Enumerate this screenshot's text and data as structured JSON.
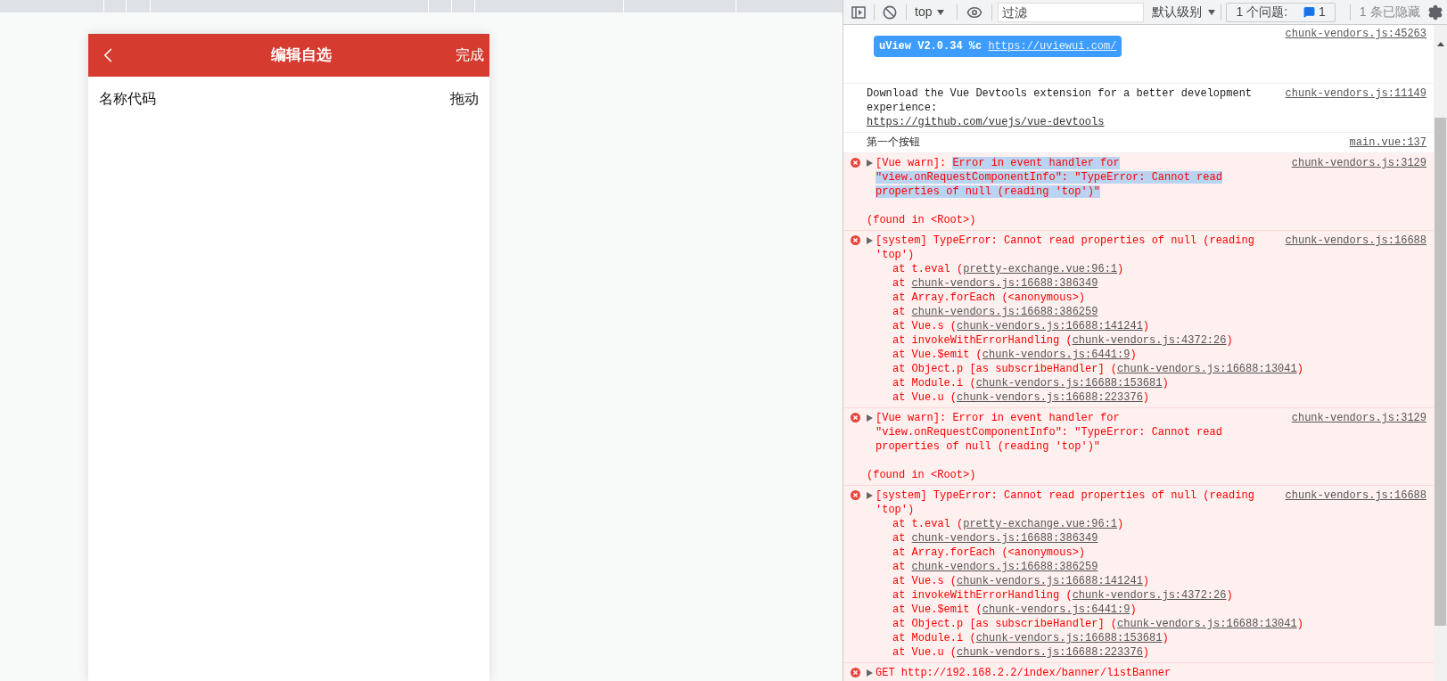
{
  "phone": {
    "header": {
      "title": "编辑自选",
      "action": "完成"
    },
    "list_header": {
      "name_column": "名称代码",
      "drag_column": "拖动"
    }
  },
  "devtools": {
    "toolbar": {
      "context": "top",
      "filter_placeholder": "过滤",
      "level": "默认级别",
      "issues_label": "1 个问题:",
      "issues_count": "1",
      "hidden": "1 条已隐藏"
    },
    "messages": [
      {
        "kind": "banner",
        "source": "chunk-vendors.js:45263",
        "badge_text": "uView V2.0.34 %c ",
        "badge_link": "https://uviewui.com/"
      },
      {
        "kind": "log",
        "source": "chunk-vendors.js:11149",
        "text": "Download the Vue Devtools extension for a better development experience:",
        "link": "https://github.com/vuejs/vue-devtools"
      },
      {
        "kind": "log",
        "source": "main.vue:137",
        "text": "第一个按钮"
      },
      {
        "kind": "error",
        "expanded": false,
        "source": "chunk-vendors.js:3129",
        "parts": [
          {
            "text": "[Vue warn]: ",
            "selected": false
          },
          {
            "text": "Error in event handler for \"view.onRequestComponentInfo\": \"TypeError: Cannot read properties of null (reading 'top')\"",
            "selected": true
          }
        ],
        "footer": "(found in <Root>)"
      },
      {
        "kind": "error",
        "expanded": false,
        "source": "chunk-vendors.js:16688",
        "parts": [
          {
            "text": "[system] TypeError: Cannot read properties of null (reading 'top')",
            "selected": false
          }
        ],
        "stack": [
          {
            "prefix": "at t.eval (",
            "link": "pretty-exchange.vue:96:1",
            "suffix": ")"
          },
          {
            "prefix": "at ",
            "link": "chunk-vendors.js:16688:386349"
          },
          {
            "prefix": "at Array.forEach (<anonymous>)"
          },
          {
            "prefix": "at ",
            "link": "chunk-vendors.js:16688:386259"
          },
          {
            "prefix": "at Vue.s (",
            "link": "chunk-vendors.js:16688:141241",
            "suffix": ")"
          },
          {
            "prefix": "at invokeWithErrorHandling (",
            "link": "chunk-vendors.js:4372:26",
            "suffix": ")"
          },
          {
            "prefix": "at Vue.$emit (",
            "link": "chunk-vendors.js:6441:9",
            "suffix": ")"
          },
          {
            "prefix": "at Object.p [as subscribeHandler] (",
            "link": "chunk-vendors.js:16688:13041",
            "suffix": ")"
          },
          {
            "prefix": "at Module.i (",
            "link": "chunk-vendors.js:16688:153681",
            "suffix": ")"
          },
          {
            "prefix": "at Vue.u (",
            "link": "chunk-vendors.js:16688:223376",
            "suffix": ")"
          }
        ]
      },
      {
        "kind": "error",
        "expanded": false,
        "source": "chunk-vendors.js:3129",
        "parts": [
          {
            "text": "[Vue warn]: ",
            "selected": false
          },
          {
            "text": "Error in event handler for \"view.onRequestComponentInfo\": \"TypeError: Cannot read properties of null (reading 'top')\"",
            "selected": false
          }
        ],
        "footer": "(found in <Root>)"
      },
      {
        "kind": "error",
        "expanded": false,
        "source": "chunk-vendors.js:16688",
        "parts": [
          {
            "text": "[system] TypeError: Cannot read properties of null (reading 'top')",
            "selected": false
          }
        ],
        "stack": [
          {
            "prefix": "at t.eval (",
            "link": "pretty-exchange.vue:96:1",
            "suffix": ")"
          },
          {
            "prefix": "at ",
            "link": "chunk-vendors.js:16688:386349"
          },
          {
            "prefix": "at Array.forEach (<anonymous>)"
          },
          {
            "prefix": "at ",
            "link": "chunk-vendors.js:16688:386259"
          },
          {
            "prefix": "at Vue.s (",
            "link": "chunk-vendors.js:16688:141241",
            "suffix": ")"
          },
          {
            "prefix": "at invokeWithErrorHandling (",
            "link": "chunk-vendors.js:4372:26",
            "suffix": ")"
          },
          {
            "prefix": "at Vue.$emit (",
            "link": "chunk-vendors.js:6441:9",
            "suffix": ")"
          },
          {
            "prefix": "at Object.p [as subscribeHandler] (",
            "link": "chunk-vendors.js:16688:13041",
            "suffix": ")"
          },
          {
            "prefix": "at Module.i (",
            "link": "chunk-vendors.js:16688:153681",
            "suffix": ")"
          },
          {
            "prefix": "at Vue.u (",
            "link": "chunk-vendors.js:16688:223376",
            "suffix": ")"
          }
        ]
      },
      {
        "kind": "error",
        "expanded": false,
        "parts": [
          {
            "text": "GET http://192.168.2.2/index/banner/listBanner",
            "selected": false
          }
        ]
      }
    ]
  }
}
